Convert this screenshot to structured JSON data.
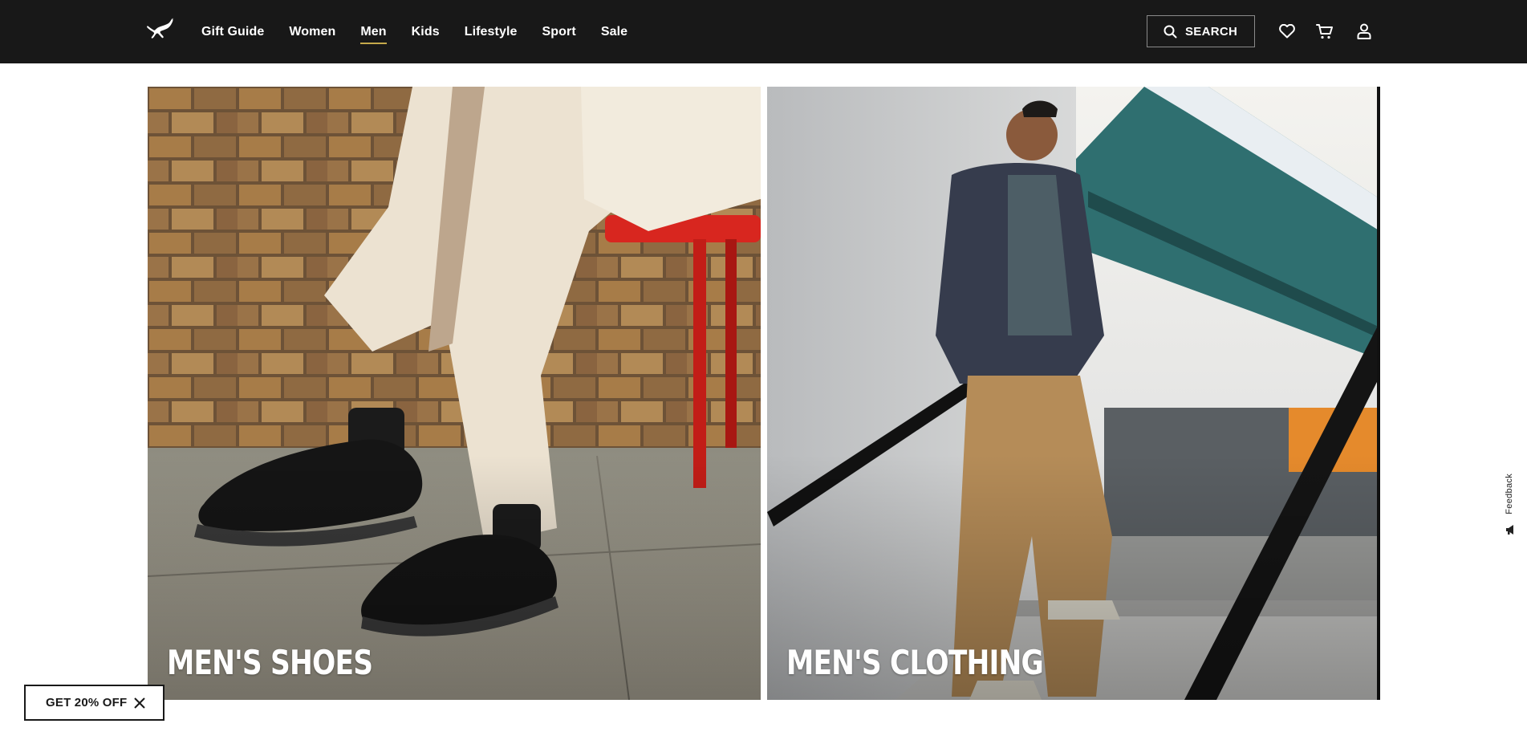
{
  "header": {
    "logo_icon": "puma-cat-logo-icon",
    "nav": [
      {
        "label": "Gift Guide",
        "active": false
      },
      {
        "label": "Women",
        "active": false
      },
      {
        "label": "Men",
        "active": true
      },
      {
        "label": "Kids",
        "active": false
      },
      {
        "label": "Lifestyle",
        "active": false
      },
      {
        "label": "Sport",
        "active": false
      },
      {
        "label": "Sale",
        "active": false
      }
    ],
    "search_label": "SEARCH",
    "icons": [
      "search-icon",
      "heart-icon",
      "cart-icon",
      "user-icon"
    ],
    "active_underline_color": "#c5a94b",
    "background": "#181818"
  },
  "tiles": [
    {
      "title": "MEN'S SHOES"
    },
    {
      "title": "MEN'S CLOTHING"
    }
  ],
  "promo": {
    "label": "GET 20% OFF",
    "close_icon": "close-icon"
  },
  "feedback": {
    "label": "Feedback",
    "icon": "megaphone-icon"
  }
}
